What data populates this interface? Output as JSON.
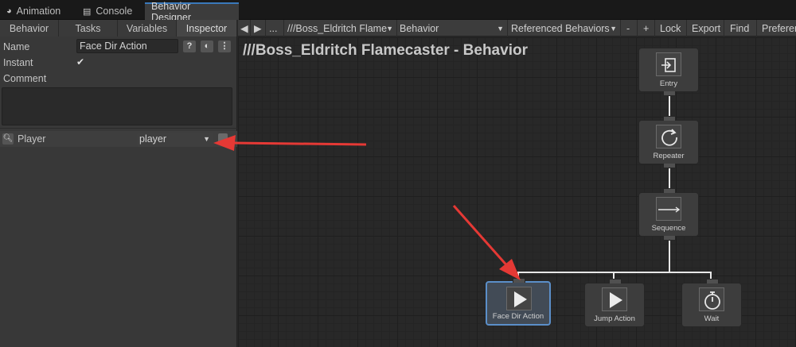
{
  "window_tabs": [
    {
      "label": "Animation",
      "icon": "animation-icon"
    },
    {
      "label": "Console",
      "icon": "console-icon"
    },
    {
      "label": "Behavior Designer",
      "icon": ""
    }
  ],
  "sub_tabs": [
    "Behavior",
    "Tasks",
    "Variables",
    "Inspector"
  ],
  "inspector": {
    "name_label": "Name",
    "name_value": "Face Dir Action",
    "instant_label": "Instant",
    "instant_checked": "✔",
    "comment_label": "Comment",
    "help_btn": "?",
    "variable_label": "Player",
    "variable_value": "player"
  },
  "toolbar": {
    "back": "◀",
    "forward": "▶",
    "more": "...",
    "object": "///Boss_Eldritch Flame",
    "behavior": "Behavior",
    "referenced": "Referenced Behaviors",
    "minus": "-",
    "plus": "+",
    "lock": "Lock",
    "export": "Export",
    "find": "Find",
    "preferences": "Preferen"
  },
  "canvas": {
    "title": "///Boss_Eldritch Flamecaster - Behavior",
    "nodes": [
      {
        "label": "Entry",
        "icon": "entry-icon"
      },
      {
        "label": "Repeater",
        "icon": "repeat-icon"
      },
      {
        "label": "Sequence",
        "icon": "sequence-arrow-icon"
      },
      {
        "label": "Face Dir Action",
        "icon": "play-icon",
        "selected": true
      },
      {
        "label": "Jump Action",
        "icon": "play-icon"
      },
      {
        "label": "Wait",
        "icon": "stopwatch-icon"
      }
    ]
  },
  "colors": {
    "accent": "#3a79bb",
    "annotation_arrow": "#e53935",
    "selection": "#5b8fc9"
  }
}
